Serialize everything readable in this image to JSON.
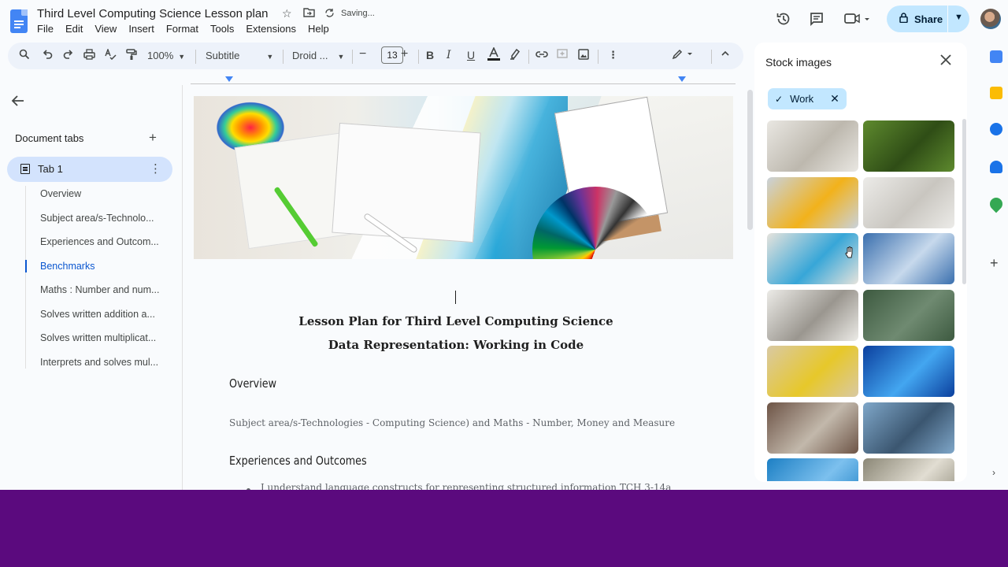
{
  "document": {
    "title": "Third Level Computing Science Lesson plan",
    "save_status": "Saving..."
  },
  "menu": [
    "File",
    "Edit",
    "View",
    "Insert",
    "Format",
    "Tools",
    "Extensions",
    "Help"
  ],
  "header": {
    "share_label": "Share",
    "icons": [
      "history-icon",
      "comment-icon",
      "video-call-icon",
      "lock-icon",
      "avatar"
    ]
  },
  "toolbar": {
    "zoom": "100%",
    "style": "Subtitle",
    "font": "Droid ...",
    "font_size": "13"
  },
  "tabs_panel": {
    "title": "Document tabs",
    "tab_label": "Tab 1",
    "outline": [
      {
        "label": "Overview",
        "active": false
      },
      {
        "label": "Subject area/s-Technolo...",
        "active": false
      },
      {
        "label": "Experiences and Outcom...",
        "active": false
      },
      {
        "label": "Benchmarks",
        "active": true
      },
      {
        "label": "Maths : Number and num...",
        "active": false
      },
      {
        "label": "Solves written addition a...",
        "active": false
      },
      {
        "label": "Solves written multiplicat...",
        "active": false
      },
      {
        "label": "Interprets and solves mul...",
        "active": false
      }
    ]
  },
  "content": {
    "heading1": "Lesson Plan for Third Level Computing Science",
    "heading2": "Data Representation: Working in Code",
    "overview_title": "Overview",
    "overview_text": "Subject area/s-Technologies - Computing Science) and Maths - Number, Money and Measure",
    "experiences_title": "Experiences and Outcomes",
    "bullet_1": "I understand language constructs for representing structured information TCH 3-14a"
  },
  "stock_panel": {
    "title": "Stock images",
    "filter_chip": "Work",
    "images": [
      {
        "name": "stock-image-building-facade",
        "colors": [
          "#e9e7e2",
          "#bdb8ae"
        ]
      },
      {
        "name": "stock-image-green-field",
        "colors": [
          "#5e8a2e",
          "#2f4d16"
        ]
      },
      {
        "name": "stock-image-robot-arm",
        "colors": [
          "#c9d2dc",
          "#f2b21b"
        ]
      },
      {
        "name": "stock-image-sketch-desk",
        "colors": [
          "#ecebe8",
          "#c9c6c0"
        ]
      },
      {
        "name": "stock-image-color-swatches",
        "colors": [
          "#e6e3dc",
          "#37a6d8"
        ]
      },
      {
        "name": "stock-image-city-skyline",
        "colors": [
          "#3a6fae",
          "#c7d9ec"
        ]
      },
      {
        "name": "stock-image-columns",
        "colors": [
          "#ecebe7",
          "#9a968f"
        ]
      },
      {
        "name": "stock-image-chalkboard",
        "colors": [
          "#3d5a40",
          "#6f8a71"
        ]
      },
      {
        "name": "stock-image-yellow-train",
        "colors": [
          "#d9c9a3",
          "#e7c82a"
        ]
      },
      {
        "name": "stock-image-circuit-board",
        "colors": [
          "#0b3f9e",
          "#43a6f0"
        ]
      },
      {
        "name": "stock-image-workshop",
        "colors": [
          "#6d5446",
          "#c2b8ab"
        ]
      },
      {
        "name": "stock-image-classroom",
        "colors": [
          "#7fa7c9",
          "#3b5670"
        ]
      },
      {
        "name": "stock-image-blue-glass",
        "colors": [
          "#1c7fc4",
          "#7cc0ee"
        ]
      },
      {
        "name": "stock-image-office-interior",
        "colors": [
          "#8b8776",
          "#e1ddd2"
        ]
      }
    ]
  },
  "side_rail": {
    "icons": [
      "calendar-icon",
      "keep-icon",
      "tasks-icon",
      "contacts-icon",
      "maps-icon"
    ],
    "colors": [
      "#4285f4",
      "#fbbc04",
      "#1a73e8",
      "#1a73e8",
      "#34a853"
    ]
  }
}
